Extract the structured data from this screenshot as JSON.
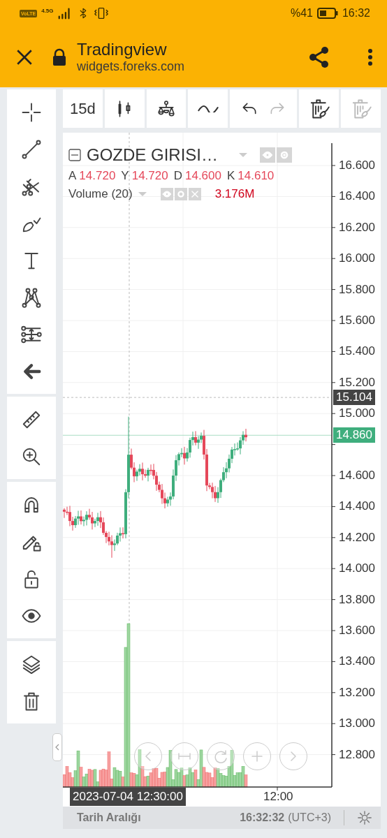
{
  "status_bar": {
    "volte": "VoLTE",
    "network": "4.5G",
    "battery_percent": "%41",
    "time": "16:32"
  },
  "browser_bar": {
    "title": "Tradingview",
    "url": "widgets.foreks.com"
  },
  "toolbar": {
    "groups": [
      [
        {
          "kind": "interval",
          "label": "15d",
          "disabled": false
        }
      ],
      [
        {
          "kind": "chart-type",
          "disabled": false
        }
      ],
      [
        {
          "kind": "indicators",
          "disabled": false
        }
      ],
      [
        {
          "kind": "compare",
          "disabled": false
        }
      ],
      [
        {
          "kind": "undo",
          "disabled": false
        },
        {
          "kind": "redo",
          "disabled": true
        }
      ],
      [
        {
          "kind": "clear-drawings",
          "disabled": false
        }
      ],
      [
        {
          "kind": "clear-all",
          "disabled": true
        }
      ]
    ]
  },
  "legend": {
    "symbol": "GOZDE GIRISI…",
    "ohlc": [
      {
        "label": "A",
        "value": "14.720"
      },
      {
        "label": "Y",
        "value": "14.720"
      },
      {
        "label": "D",
        "value": "14.600"
      },
      {
        "label": "K",
        "value": "14.610"
      }
    ],
    "volume": {
      "label": "Volume (20)",
      "value": "3.176M"
    }
  },
  "price_axis": {
    "ticks_upper": [
      "16.600",
      "16.400",
      "16.200",
      "16.000",
      "15.800",
      "15.600",
      "15.400",
      "15.200",
      "15.000"
    ],
    "ticks_lower": [
      "14.600",
      "14.400",
      "14.200",
      "14.000",
      "13.800",
      "13.600",
      "13.400",
      "13.200",
      "13.000",
      "12.800"
    ],
    "crosshair_price": "15.104",
    "last_price": "14.860"
  },
  "time_axis": {
    "crosshair_time": "2023-07-04 12:30:00",
    "ticks": [
      "12:00"
    ]
  },
  "footer": {
    "date_range": "Tarih Aralığı",
    "time": "16:32:32",
    "timezone": "(UTC+3)"
  }
}
